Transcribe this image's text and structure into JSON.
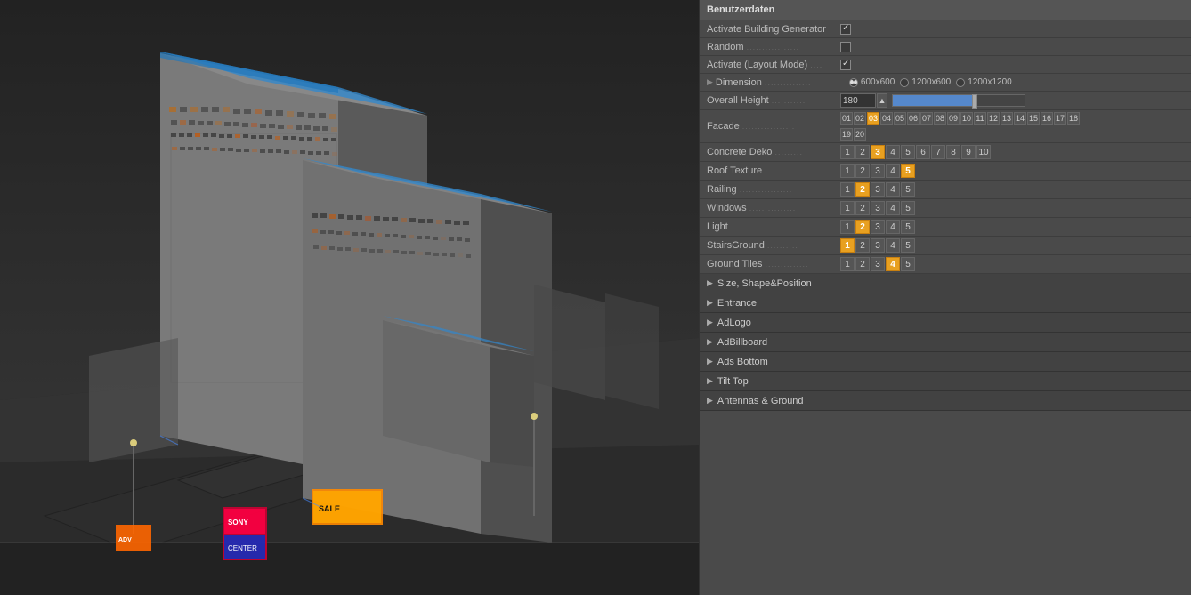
{
  "panel": {
    "title": "Benutzerdaten",
    "rows": [
      {
        "id": "activate-building-generator",
        "label": "Activate Building Generator",
        "dots": "",
        "type": "checkbox",
        "checked": true
      },
      {
        "id": "random",
        "label": "Random",
        "dots": ".................",
        "type": "checkbox",
        "checked": false
      },
      {
        "id": "activate-layout-mode",
        "label": "Activate (Layout Mode)",
        "dots": "....",
        "type": "checkbox",
        "checked": true
      },
      {
        "id": "dimension",
        "label": "Dimension",
        "dots": "...............",
        "type": "radio",
        "options": [
          "600x600",
          "1200x600",
          "1200x1200"
        ],
        "selected": 0
      },
      {
        "id": "overall-height",
        "label": "Overall Height",
        "dots": "...........",
        "type": "height",
        "value": "180"
      },
      {
        "id": "facade",
        "label": "Facade",
        "dots": ".................",
        "type": "facade-nums",
        "values": [
          "01",
          "02",
          "03",
          "04",
          "05",
          "06",
          "07",
          "08",
          "09",
          "10",
          "11",
          "12",
          "13",
          "14",
          "15",
          "16",
          "17",
          "18",
          "19",
          "20"
        ],
        "active": "03"
      },
      {
        "id": "concrete-deko",
        "label": "Concrete Deko",
        "dots": ".........",
        "type": "nums",
        "values": [
          "1",
          "2",
          "3",
          "4",
          "5",
          "6",
          "7",
          "8",
          "9",
          "10"
        ],
        "active": "3"
      },
      {
        "id": "roof-texture",
        "label": "Roof Texture",
        "dots": "..........",
        "type": "nums5",
        "values": [
          "1",
          "2",
          "3",
          "4",
          "5"
        ],
        "active": "5"
      },
      {
        "id": "railing",
        "label": "Railing",
        "dots": ".................",
        "type": "nums5",
        "values": [
          "1",
          "2",
          "3",
          "4",
          "5"
        ],
        "active": "2"
      },
      {
        "id": "windows",
        "label": "Windows",
        "dots": "...............",
        "type": "nums5",
        "values": [
          "1",
          "2",
          "3",
          "4",
          "5"
        ],
        "active": ""
      },
      {
        "id": "light",
        "label": "Light",
        "dots": "...................",
        "type": "nums5",
        "values": [
          "1",
          "2",
          "3",
          "4",
          "5"
        ],
        "active": "2"
      },
      {
        "id": "stairs-ground",
        "label": "StairsGround",
        "dots": "..........",
        "type": "nums5",
        "values": [
          "1",
          "2",
          "3",
          "4",
          "5"
        ],
        "active": "1"
      },
      {
        "id": "ground-tiles",
        "label": "Ground Tiles",
        "dots": "..............",
        "type": "nums5",
        "values": [
          "1",
          "2",
          "3",
          "4",
          "5"
        ],
        "active": "4"
      }
    ],
    "sections": [
      {
        "id": "size-shape",
        "label": "Size, Shape&Position"
      },
      {
        "id": "entrance",
        "label": "Entrance"
      },
      {
        "id": "adlogo",
        "label": "AdLogo"
      },
      {
        "id": "adbillboard",
        "label": "AdBillboard"
      },
      {
        "id": "ads-bottom",
        "label": "Ads Bottom"
      },
      {
        "id": "tilt-top",
        "label": "Tilt Top"
      },
      {
        "id": "antennas-ground",
        "label": "Antennas & Ground"
      }
    ]
  },
  "viewport": {
    "label": "3D Building Viewport"
  }
}
